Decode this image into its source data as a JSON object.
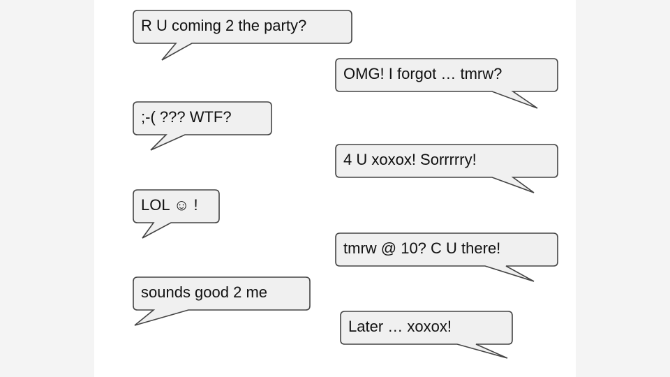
{
  "messages": [
    {
      "text": "R U coming 2 the party?",
      "side": "left"
    },
    {
      "text": "OMG! I forgot … tmrw?",
      "side": "right"
    },
    {
      "text": ";-(  ???  WTF?",
      "side": "left"
    },
    {
      "text": "4 U xoxox! Sorrrrry!",
      "side": "right"
    },
    {
      "text": "LOL ☺ !",
      "side": "left"
    },
    {
      "text": "tmrw @ 10? C U there!",
      "side": "right"
    },
    {
      "text": "sounds good 2 me",
      "side": "left"
    },
    {
      "text": "Later … xoxox!",
      "side": "right"
    }
  ]
}
